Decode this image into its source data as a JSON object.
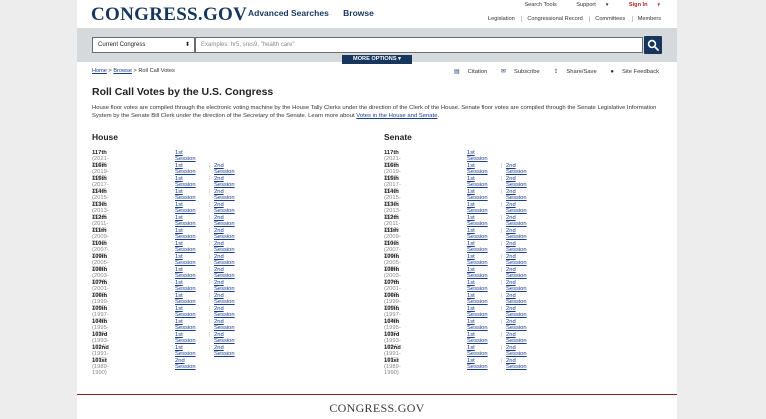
{
  "header": {
    "logo": "CONGRESS.GOV",
    "nav": [
      "Advanced Searches",
      "Browse"
    ],
    "utility": [
      "Search Tools",
      "Support",
      "Sign In"
    ],
    "secondary": [
      "Legislation",
      "Congressional Record",
      "Committees",
      "Members"
    ]
  },
  "search": {
    "scope": "Current Congress",
    "placeholder": "Examples: hr5, sres9, \"health care\"",
    "more_options": "MORE OPTIONS"
  },
  "breadcrumb": {
    "home": "Home",
    "sep": ">",
    "browse": "Browse",
    "current": "Roll Call Votes"
  },
  "tools": [
    "Citation",
    "Subscribe",
    "Share/Save",
    "Site Feedback"
  ],
  "page": {
    "title": "Roll Call Votes by the U.S. Congress",
    "intro": "House floor votes are compiled through the electronic voting machine by the House Tally Clerks under the direction of the Clerk of the House. Senate floor votes are compiled through the Senate Legislative Information System by the Senate Bill Clerk under the direction of the Secretary of the Senate. Learn more about ",
    "intro_link": "Votes in the House and Senate",
    "intro_end": "."
  },
  "house": {
    "heading": "House",
    "rows": [
      {
        "congress": "117th",
        "years": "(2021-2022)",
        "s1": "1st Session",
        "s2": ""
      },
      {
        "congress": "116th",
        "years": "(2019-2020)",
        "s1": "1st Session",
        "s2": "2nd Session"
      },
      {
        "congress": "115th",
        "years": "(2017-2018)",
        "s1": "1st Session",
        "s2": "2nd Session"
      },
      {
        "congress": "114th",
        "years": "(2015-2016)",
        "s1": "1st Session",
        "s2": "2nd Session"
      },
      {
        "congress": "113th",
        "years": "(2013-2014)",
        "s1": "1st Session",
        "s2": "2nd Session"
      },
      {
        "congress": "112th",
        "years": "(2011-2012)",
        "s1": "1st Session",
        "s2": "2nd Session"
      },
      {
        "congress": "111th",
        "years": "(2009-2010)",
        "s1": "1st Session",
        "s2": "2nd Session"
      },
      {
        "congress": "110th",
        "years": "(2007-2008)",
        "s1": "1st Session",
        "s2": "2nd Session"
      },
      {
        "congress": "109th",
        "years": "(2005-2006)",
        "s1": "1st Session",
        "s2": "2nd Session"
      },
      {
        "congress": "108th",
        "years": "(2003-2004)",
        "s1": "1st Session",
        "s2": "2nd Session"
      },
      {
        "congress": "107th",
        "years": "(2001-2002)",
        "s1": "1st Session",
        "s2": "2nd Session"
      },
      {
        "congress": "106th",
        "years": "(1999-2000)",
        "s1": "1st Session",
        "s2": "2nd Session"
      },
      {
        "congress": "105th",
        "years": "(1997-1998)",
        "s1": "1st Session",
        "s2": "2nd Session"
      },
      {
        "congress": "104th",
        "years": "(1995-1996)",
        "s1": "1st Session",
        "s2": "2nd Session"
      },
      {
        "congress": "103rd",
        "years": "(1993-1994)",
        "s1": "1st Session",
        "s2": "2nd Session"
      },
      {
        "congress": "102nd",
        "years": "(1991-1992)",
        "s1": "1st Session",
        "s2": "2nd Session"
      },
      {
        "congress": "101st",
        "years": "(1989-1990)",
        "s1": "",
        "s2": "2nd Session"
      }
    ]
  },
  "senate": {
    "heading": "Senate",
    "rows": [
      {
        "congress": "117th",
        "years": "(2021-2022)",
        "s1": "1st Session",
        "s2": ""
      },
      {
        "congress": "116th",
        "years": "(2019-2020)",
        "s1": "1st Session",
        "s2": "2nd Session"
      },
      {
        "congress": "115th",
        "years": "(2017-2018)",
        "s1": "1st Session",
        "s2": "2nd Session"
      },
      {
        "congress": "114th",
        "years": "(2015-2016)",
        "s1": "1st Session",
        "s2": "2nd Session"
      },
      {
        "congress": "113th",
        "years": "(2013-2014)",
        "s1": "1st Session",
        "s2": "2nd Session"
      },
      {
        "congress": "112th",
        "years": "(2011-2012)",
        "s1": "1st Session",
        "s2": "2nd Session"
      },
      {
        "congress": "111th",
        "years": "(2009-2010)",
        "s1": "1st Session",
        "s2": "2nd Session"
      },
      {
        "congress": "110th",
        "years": "(2007-2008)",
        "s1": "1st Session",
        "s2": "2nd Session"
      },
      {
        "congress": "109th",
        "years": "(2005-2006)",
        "s1": "1st Session",
        "s2": "2nd Session"
      },
      {
        "congress": "108th",
        "years": "(2003-2004)",
        "s1": "1st Session",
        "s2": "2nd Session"
      },
      {
        "congress": "107th",
        "years": "(2001-2002)",
        "s1": "1st Session",
        "s2": "2nd Session"
      },
      {
        "congress": "106th",
        "years": "(1999-2000)",
        "s1": "1st Session",
        "s2": "2nd Session"
      },
      {
        "congress": "105th",
        "years": "(1997-1998)",
        "s1": "1st Session",
        "s2": "2nd Session"
      },
      {
        "congress": "104th",
        "years": "(1995-1996)",
        "s1": "1st Session",
        "s2": "2nd Session"
      },
      {
        "congress": "103rd",
        "years": "(1993-1994)",
        "s1": "1st Session",
        "s2": "2nd Session"
      },
      {
        "congress": "102nd",
        "years": "(1991-1992)",
        "s1": "1st Session",
        "s2": "2nd Session"
      },
      {
        "congress": "101st",
        "years": "(1989-1990)",
        "s1": "1st Session",
        "s2": "2nd Session"
      }
    ]
  },
  "footer": {
    "logo": "CONGRESS.GOV"
  },
  "colors": {
    "navy": "#17365d",
    "link": "#1b3d8f",
    "signin": "#b22222",
    "footer_rule": "#8b1e1e"
  }
}
